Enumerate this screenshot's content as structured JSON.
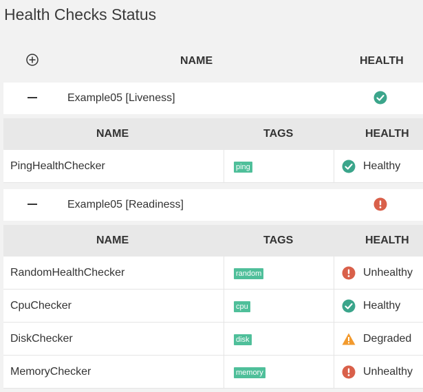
{
  "page": {
    "title": "Health Checks Status"
  },
  "header": {
    "name_label": "NAME",
    "health_label": "HEALTH"
  },
  "colors": {
    "healthy": "#3ba58b",
    "unhealthy": "#d9604a",
    "degraded": "#f29a2e",
    "tag": "#4fbf9a"
  },
  "groups": [
    {
      "name": "Example05 [Liveness]",
      "status_icon": "check-circle-icon",
      "columns": {
        "name": "NAME",
        "tags": "TAGS",
        "health": "HEALTH"
      },
      "rows": [
        {
          "name": "PingHealthChecker",
          "tag": "ping",
          "status": "Healthy",
          "status_icon": "check-circle-icon"
        }
      ]
    },
    {
      "name": "Example05 [Readiness]",
      "status_icon": "exclamation-circle-icon",
      "columns": {
        "name": "NAME",
        "tags": "TAGS",
        "health": "HEALTH"
      },
      "rows": [
        {
          "name": "RandomHealthChecker",
          "tag": "random",
          "status": "Unhealthy",
          "status_icon": "exclamation-circle-icon"
        },
        {
          "name": "CpuChecker",
          "tag": "cpu",
          "status": "Healthy",
          "status_icon": "check-circle-icon"
        },
        {
          "name": "DiskChecker",
          "tag": "disk",
          "status": "Degraded",
          "status_icon": "warning-triangle-icon"
        },
        {
          "name": "MemoryChecker",
          "tag": "memory",
          "status": "Unhealthy",
          "status_icon": "exclamation-circle-icon"
        }
      ]
    }
  ]
}
